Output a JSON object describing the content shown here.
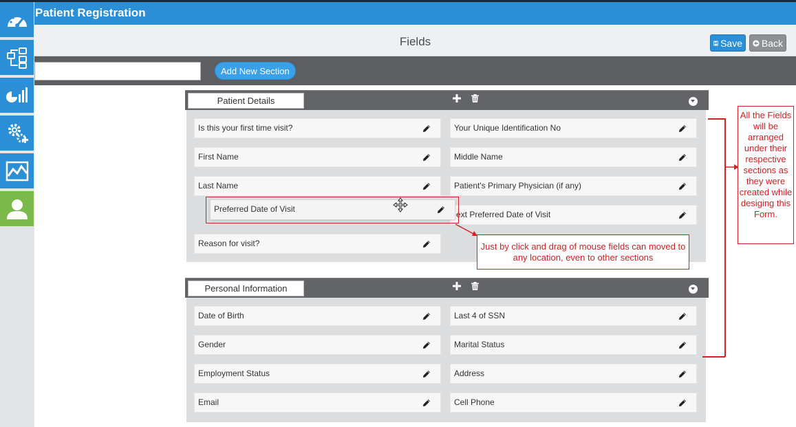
{
  "app": {
    "title": "Patient Registration"
  },
  "page": {
    "title": "Fields"
  },
  "buttons": {
    "save": "Save",
    "back": "Back",
    "add_section": "Add New Section"
  },
  "toolbar": {
    "section_name_value": ""
  },
  "sidebar": {
    "items": [
      {
        "icon": "dashboard-gauge-icon"
      },
      {
        "icon": "workflow-icon"
      },
      {
        "icon": "reports-chart-icon"
      },
      {
        "icon": "settings-gears-icon"
      },
      {
        "icon": "analytics-trend-icon"
      },
      {
        "icon": "user-icon",
        "active": true
      }
    ]
  },
  "sections": [
    {
      "name": "Patient Details",
      "fields": [
        "Is this your first time visit?",
        "Your Unique Identification No",
        "First Name",
        "Middle Name",
        "Last Name",
        "Patient's Primary Physician (if any)",
        "Preferred Date of Visit",
        "ext Preferred Date of Visit",
        "Reason for visit?"
      ]
    },
    {
      "name": "Personal Information",
      "fields": [
        "Date of Birth",
        "Last 4 of SSN",
        "Gender",
        "Marital Status",
        "Employment Status",
        "Address",
        "Email",
        "Cell Phone"
      ]
    }
  ],
  "annotations": {
    "drag_note": "Just by click and drag of mouse fields can moved to any location, even to other sections",
    "sections_note": "All the Fields will be arranged under their respective sections as they were created while desiging this Form."
  },
  "colors": {
    "primary": "#2a8fd6",
    "active_sidebar": "#7ab94a",
    "section_header": "#636467",
    "annotation_red": "#d52020"
  }
}
